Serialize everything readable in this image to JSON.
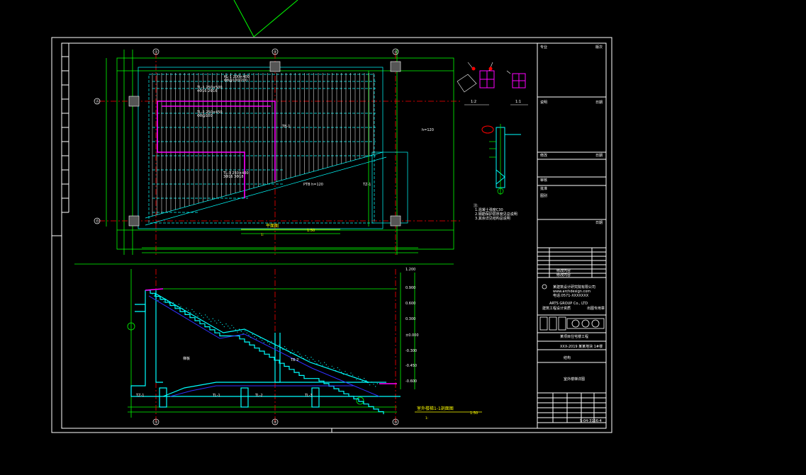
{
  "drawing": {
    "plan_title": "平面图",
    "plan_scale_note": "1:",
    "plan_scale": "1:50",
    "section_title": "室外楼梯1-1剖面图",
    "section_scale_note": "1:",
    "section_scale": "1:50",
    "detail_1": "1:2",
    "detail_2": "1:1",
    "company_en": "ARTS GROUP Co., LTD",
    "footer_left": "",
    "footer_stamp": "",
    "grid_labels_top": [
      "①",
      "②",
      "③"
    ],
    "grid_labels_left": [
      "Ⓐ",
      "Ⓑ"
    ],
    "drawing_no": "S-04-3156-4",
    "colors": {
      "background": "#000000",
      "frame": "#ffffff",
      "green": "#00ff00",
      "cyan": "#00ffff",
      "magenta": "#ff00ff",
      "blue": "#0000ff",
      "red": "#ff0000",
      "yellow": "#ffff00"
    }
  }
}
